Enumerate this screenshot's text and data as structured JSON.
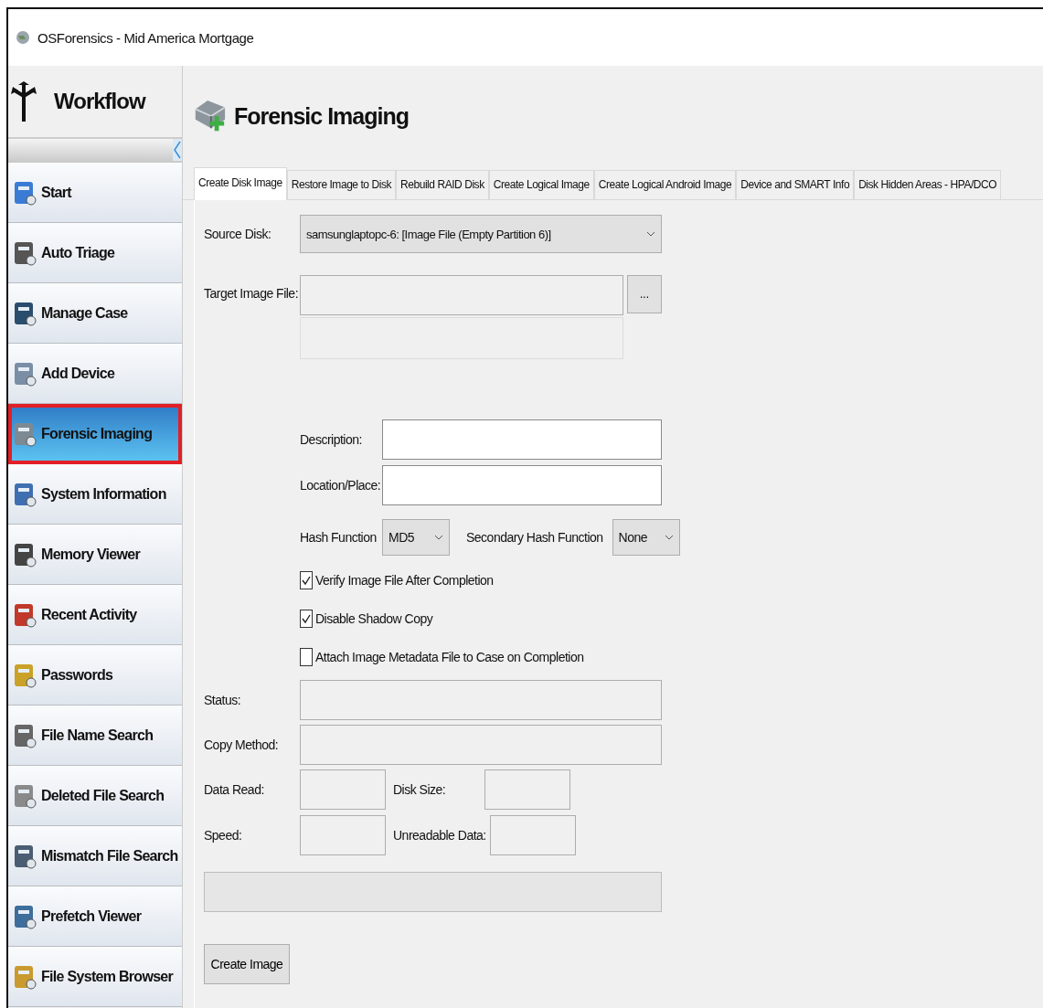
{
  "window": {
    "title": "OSForensics - Mid America Mortgage"
  },
  "sidebar": {
    "title": "Workflow",
    "items": [
      {
        "label": "Start",
        "selected": false,
        "highlighted": false
      },
      {
        "label": "Auto Triage",
        "selected": false,
        "highlighted": false
      },
      {
        "label": "Manage Case",
        "selected": false,
        "highlighted": false
      },
      {
        "label": "Add Device",
        "selected": false,
        "highlighted": false
      },
      {
        "label": "Forensic Imaging",
        "selected": true,
        "highlighted": true
      },
      {
        "label": "System Information",
        "selected": false,
        "highlighted": false
      },
      {
        "label": "Memory Viewer",
        "selected": false,
        "highlighted": false
      },
      {
        "label": "Recent Activity",
        "selected": false,
        "highlighted": false
      },
      {
        "label": "Passwords",
        "selected": false,
        "highlighted": false
      },
      {
        "label": "File Name Search",
        "selected": false,
        "highlighted": false
      },
      {
        "label": "Deleted File Search",
        "selected": false,
        "highlighted": false
      },
      {
        "label": "Mismatch File Search",
        "selected": false,
        "highlighted": false
      },
      {
        "label": "Prefetch Viewer",
        "selected": false,
        "highlighted": false
      },
      {
        "label": "File System Browser",
        "selected": false,
        "highlighted": false
      }
    ]
  },
  "page": {
    "title": "Forensic Imaging"
  },
  "tabs": [
    {
      "label": "Create Disk Image",
      "selected": true
    },
    {
      "label": "Restore Image to Disk",
      "selected": false
    },
    {
      "label": "Rebuild RAID Disk",
      "selected": false
    },
    {
      "label": "Create Logical Image",
      "selected": false
    },
    {
      "label": "Create Logical Android Image",
      "selected": false
    },
    {
      "label": "Device and SMART Info",
      "selected": false
    },
    {
      "label": "Disk Hidden Areas - HPA/DCO",
      "selected": false
    }
  ],
  "form": {
    "source_disk": {
      "label": "Source Disk:",
      "value": "samsunglaptopc-6: [Image File (Empty Partition 6)]"
    },
    "target_image_file": {
      "label": "Target Image File:",
      "browse": "..."
    },
    "description": {
      "label": "Description:"
    },
    "location": {
      "label": "Location/Place:"
    },
    "hash_function": {
      "label": "Hash Function",
      "value": "MD5"
    },
    "secondary_hash_function": {
      "label": "Secondary Hash Function",
      "value": "None"
    },
    "options": [
      {
        "label": "Verify Image File After Completion",
        "checked": true
      },
      {
        "label": "Disable Shadow Copy",
        "checked": true
      },
      {
        "label": "Attach Image Metadata File to Case on Completion",
        "checked": false
      }
    ],
    "status": {
      "label": "Status:"
    },
    "copy_method": {
      "label": "Copy Method:"
    },
    "data_read": {
      "label": "Data Read:"
    },
    "disk_size": {
      "label": "Disk Size:"
    },
    "speed": {
      "label": "Speed:"
    },
    "unreadable_data": {
      "label": "Unreadable Data:"
    },
    "progress": {
      "level": 0
    },
    "create_button": "Create Image"
  }
}
